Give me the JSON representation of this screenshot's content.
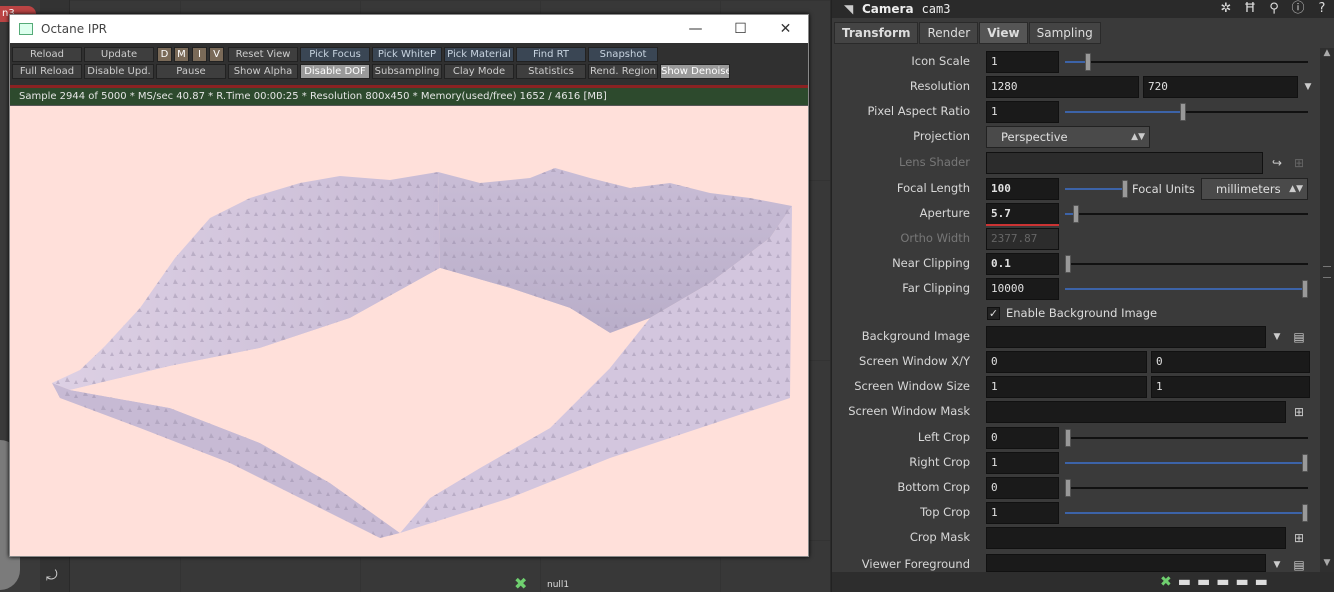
{
  "network": {
    "red_tab_label": "n3",
    "null_node_label": "null1",
    "nav_icon": "arrow-icon"
  },
  "ipr": {
    "title": "Octane IPR",
    "toolbar_row1": [
      "Reload",
      "Update",
      "D",
      "M",
      "I",
      "V",
      "Reset View",
      "Pick Focus",
      "Pick WhiteP",
      "Pick Material",
      "Find RT",
      "Snapshot"
    ],
    "toolbar_row2": [
      "Full Reload",
      "Disable Upd.",
      "Pause",
      "Show Alpha",
      "Disable DOF",
      "Subsampling",
      "Clay Mode",
      "Statistics",
      "Rend. Region",
      "Show Denoise"
    ],
    "status": "Sample 2944 of 5000 * MS/sec 40.87 * R.Time 00:00:25 * Resolution 800x450 * Memory(used/free) 1652 / 4616 [MB]"
  },
  "pane": {
    "node_type": "Camera",
    "node_name": "cam3",
    "tabs": [
      "Transform",
      "Render",
      "View",
      "Sampling"
    ],
    "active_tab": "View",
    "icon_scale_label": "Icon Scale",
    "icon_scale": "1",
    "resolution_label": "Resolution",
    "resolution_x": "1280",
    "resolution_y": "720",
    "par_label": "Pixel Aspect Ratio",
    "par": "1",
    "projection_label": "Projection",
    "projection": "Perspective",
    "lens_shader_label": "Lens Shader",
    "focal_length_label": "Focal Length",
    "focal_length": "100",
    "focal_units_label": "Focal Units",
    "focal_units": "millimeters",
    "aperture_label": "Aperture",
    "aperture": "5.7",
    "ortho_width_label": "Ortho Width",
    "ortho_width": "2377.87",
    "near_clip_label": "Near Clipping",
    "near_clip": "0.1",
    "far_clip_label": "Far Clipping",
    "far_clip": "10000",
    "enable_bg_label": "Enable Background Image",
    "bg_image_label": "Background Image",
    "sw_xy_label": "Screen Window X/Y",
    "sw_x": "0",
    "sw_y": "0",
    "sw_size_label": "Screen Window Size",
    "sw_size_x": "1",
    "sw_size_y": "1",
    "sw_mask_label": "Screen Window Mask",
    "left_crop_label": "Left Crop",
    "left_crop": "0",
    "right_crop_label": "Right Crop",
    "right_crop": "1",
    "bottom_crop_label": "Bottom Crop",
    "bottom_crop": "0",
    "top_crop_label": "Top Crop",
    "top_crop": "1",
    "crop_mask_label": "Crop Mask",
    "viewer_fg_label": "Viewer Foreground"
  },
  "colors": {
    "viewport_bg": "#ffe0da",
    "terrain": "#d8cbe0",
    "slider_fill": "#3c63a8",
    "status_bg": "#2d4a2d"
  }
}
